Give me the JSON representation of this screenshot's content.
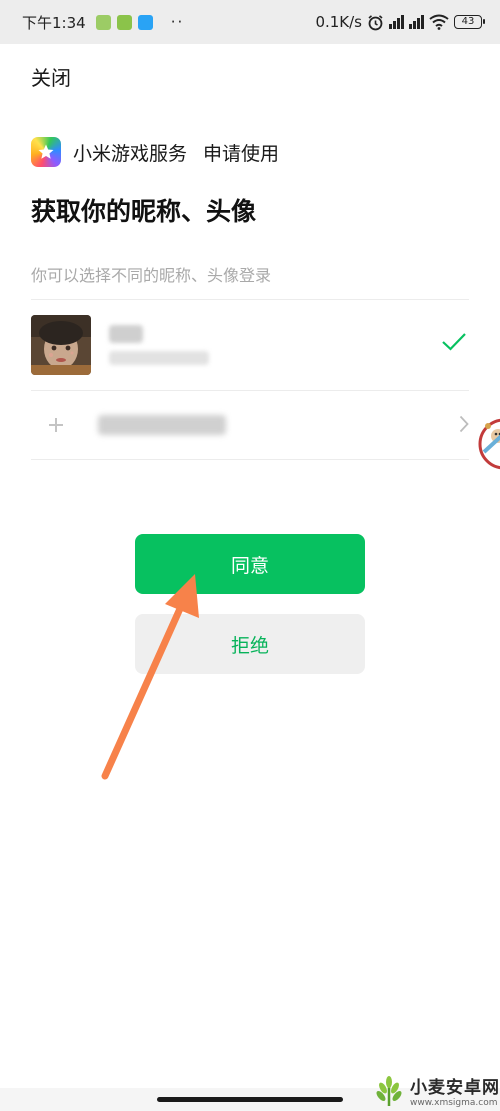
{
  "status_bar": {
    "time": "下午1:34",
    "speed": "0.1K/s",
    "battery": "43",
    "icons": [
      "app-notification-icon",
      "app-notification-icon",
      "cloud-icon",
      "more-dots-icon",
      "alarm-icon",
      "signal-hd-icon",
      "signal-hd-icon",
      "wifi-icon",
      "battery-icon"
    ]
  },
  "header": {
    "close_label": "关闭"
  },
  "app": {
    "name": "小米游戏服务",
    "request": "申请使用"
  },
  "page": {
    "title": "获取你的昵称、头像",
    "hint": "你可以选择不同的昵称、头像登录"
  },
  "colors": {
    "primary": "#07c160",
    "reject_text": "#07b35a",
    "arrow": "#f7824a"
  },
  "actions": {
    "agree_label": "同意",
    "reject_label": "拒绝"
  },
  "watermark": {
    "text": "小麦安卓网",
    "url": "www.xmsigma.com"
  }
}
